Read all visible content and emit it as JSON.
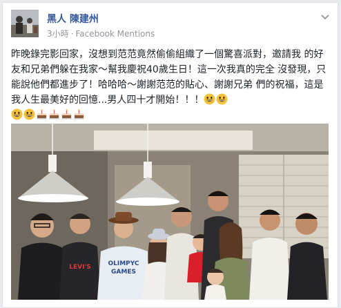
{
  "post": {
    "author": "黑人 陳建州",
    "time": "3小時",
    "separator": "·",
    "source": "Facebook Mentions",
    "text_lines": [
      "昨晚錄完影回家，沒想到范范竟然偷偷組織了一個驚喜派對，邀請我",
      "的好友和兄弟們躲在我家～幫我慶祝40歲生日！這一次我真的完全",
      "沒發現，只能說他們都進步了！哈哈哈～謝謝范范的貼心、謝謝兄弟",
      "們的祝福，這是我人生最美好的回憶...男人四十才開始！！！"
    ],
    "line4_emojis": [
      "grinning-face-emoji",
      "grinning-face-emoji"
    ],
    "line5_emojis": [
      "grinning-face-emoji",
      "grinning-face-emoji",
      "birthday-cake-emoji",
      "birthday-cake-emoji",
      "birthday-cake-emoji",
      "birthday-cake-emoji"
    ],
    "photo": {
      "shirt_text_1": "LEVI'S",
      "shirt_text_2": "OLIMPYC",
      "shirt_text_3": "GAMES"
    }
  },
  "colors": {
    "author": "#365899",
    "meta": "#90949c",
    "text": "#1d2129",
    "page_bg": "#e9ebee"
  }
}
